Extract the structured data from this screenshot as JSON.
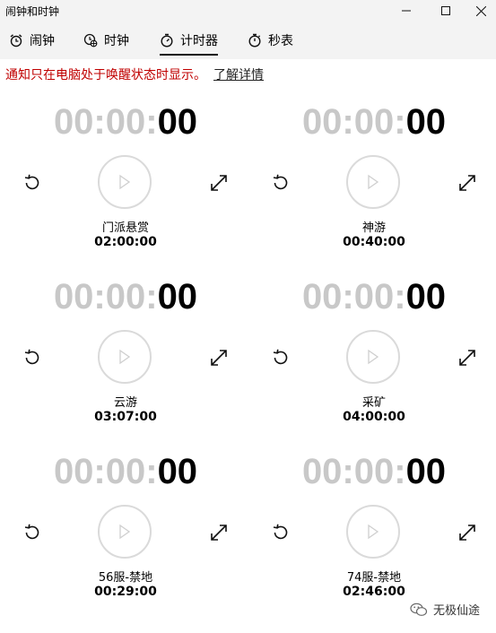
{
  "window": {
    "title": "闹钟和时钟"
  },
  "tabs": [
    {
      "label": "闹钟",
      "icon": "alarm-icon"
    },
    {
      "label": "时钟",
      "icon": "world-clock-icon"
    },
    {
      "label": "计时器",
      "icon": "timer-icon",
      "active": true
    },
    {
      "label": "秒表",
      "icon": "stopwatch-icon"
    }
  ],
  "notice": {
    "text": "通知只在电脑处于唤醒状态时显示。",
    "link": "了解详情"
  },
  "timers": [
    {
      "time_dim": "00:00:",
      "time_hi": "00",
      "name": "门派悬赏",
      "duration": "02:00:00"
    },
    {
      "time_dim": "00:00:",
      "time_hi": "00",
      "name": "神游",
      "duration": "00:40:00"
    },
    {
      "time_dim": "00:00:",
      "time_hi": "00",
      "name": "云游",
      "duration": "03:07:00"
    },
    {
      "time_dim": "00:00:",
      "time_hi": "00",
      "name": "采矿",
      "duration": "04:00:00"
    },
    {
      "time_dim": "00:00:",
      "time_hi": "00",
      "name": "56服-禁地",
      "duration": "00:29:00"
    },
    {
      "time_dim": "00:00:",
      "time_hi": "00",
      "name": "74服-禁地",
      "duration": "02:46:00"
    }
  ],
  "watermark": {
    "text": "无极仙途"
  },
  "colors": {
    "notice": "#c00000",
    "dim_digits": "#c8c8c8",
    "chrome": "#f3f3f3"
  }
}
